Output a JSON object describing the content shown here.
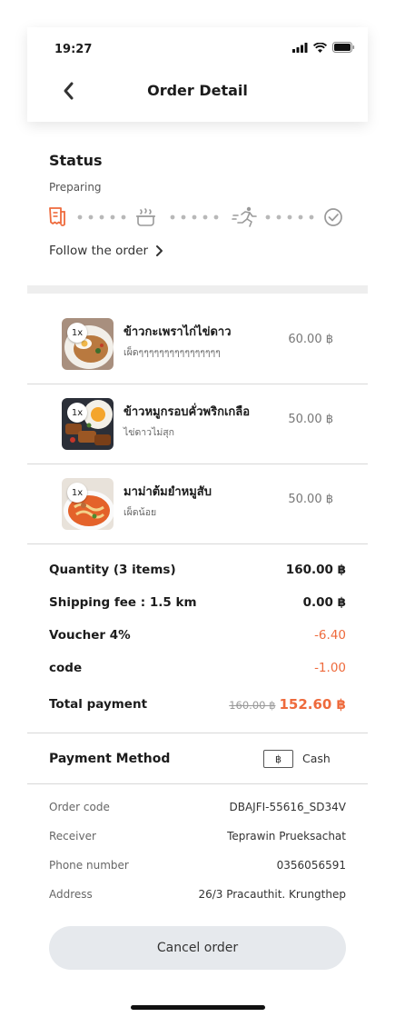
{
  "status_bar": {
    "time": "19:27"
  },
  "header": {
    "title": "Order Detail"
  },
  "status": {
    "title": "Status",
    "current": "Preparing",
    "follow_label": "Follow the order",
    "active_color": "#ee6a3c",
    "steps": [
      "receipt-icon",
      "cooking-pot-icon",
      "runner-icon",
      "check-circle-icon"
    ]
  },
  "items": [
    {
      "qty": "1x",
      "name": "ข้าวกะเพราไก่ไข่ดาว",
      "note": "เผ็ดๆๆๆๆๆๆๆๆๆๆๆๆๆๆๆๆ",
      "price": "60.00 ฿"
    },
    {
      "qty": "1x",
      "name": "ข้าวหมูกรอบคั่วพริกเกลือ",
      "note": "ไข่ดาวไม่สุก",
      "price": "50.00 ฿"
    },
    {
      "qty": "1x",
      "name": "มาม่าต้มยำหมูสับ",
      "note": "เผ็ดน้อย",
      "price": "50.00 ฿"
    }
  ],
  "summary": {
    "quantity_label": "Quantity  (3 items)",
    "quantity_value": "160.00 ฿",
    "shipping_label": "Shipping fee : 1.5 km",
    "shipping_value": "0.00 ฿",
    "voucher_label": "Voucher 4%",
    "voucher_value": "-6.40",
    "code_label": "code",
    "code_value": "-1.00",
    "total_label": "Total payment",
    "total_original": "160.00 ฿",
    "total_value": "152.60 ฿"
  },
  "payment": {
    "label": "Payment Method",
    "icon_text": "฿",
    "method": "Cash"
  },
  "info": [
    {
      "label": "Order code",
      "value": "DBAJFI-55616_SD34V"
    },
    {
      "label": "Receiver",
      "value": "Teprawin Prueksachat"
    },
    {
      "label": "Phone number",
      "value": "0356056591"
    },
    {
      "label": "Address",
      "value": "26/3 Pracauthit. Krungthep"
    }
  ],
  "cancel_label": "Cancel order"
}
